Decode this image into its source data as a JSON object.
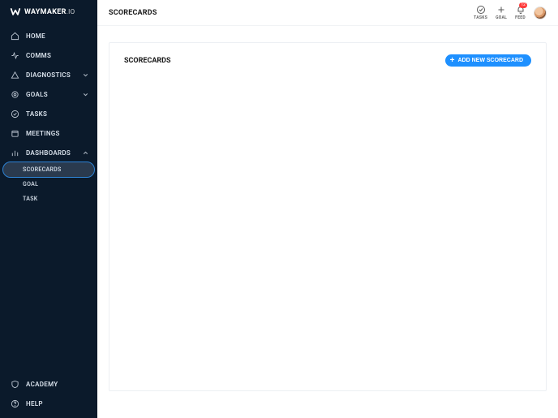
{
  "brand": {
    "name": "WAYMAKER",
    "suffix": ".IO"
  },
  "sidebar": {
    "items": [
      {
        "label": "HOME"
      },
      {
        "label": "COMMS"
      },
      {
        "label": "DIAGNOSTICS"
      },
      {
        "label": "GOALS"
      },
      {
        "label": "TASKS"
      },
      {
        "label": "MEETINGS"
      },
      {
        "label": "DASHBOARDS"
      }
    ],
    "dashboards_children": [
      {
        "label": "SCORECARDS"
      },
      {
        "label": "GOAL"
      },
      {
        "label": "TASK"
      }
    ],
    "bottom": [
      {
        "label": "ACADEMY"
      },
      {
        "label": "HELP"
      }
    ]
  },
  "header": {
    "title": "SCORECARDS",
    "actions": [
      {
        "label": "TASKS"
      },
      {
        "label": "GOAL"
      },
      {
        "label": "FEED",
        "badge": "12"
      }
    ]
  },
  "card": {
    "title": "SCORECARDS",
    "add_label": "ADD NEW SCORECARD"
  }
}
